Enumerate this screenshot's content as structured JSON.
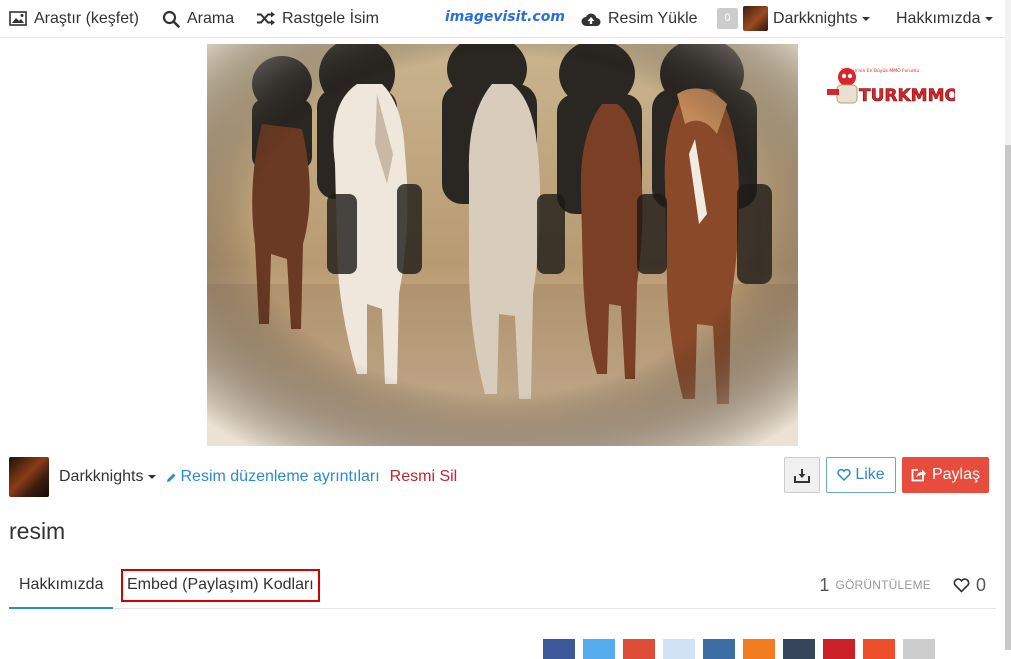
{
  "nav": {
    "explore_label": "Araştır (keşfet)",
    "search_label": "Arama",
    "random_label": "Rastgele İsim",
    "logo_text": "imagevisit.com",
    "upload_label": "Resim Yükle",
    "notification_count": "0",
    "user_label": "Darkknights",
    "about_label": "Hakkımızda"
  },
  "ad": {
    "brand_text": "TURKMMO",
    "tagline": "Türkiye'nin En Büyük MMO Forumu"
  },
  "owner": {
    "name": "Darkknights",
    "edit_label": "Resim düzenleme ayrıntıları",
    "delete_label": "Resmi Sil"
  },
  "actions": {
    "like_label": "Like",
    "share_label": "Paylaş"
  },
  "image": {
    "title": "resim"
  },
  "tabs": [
    {
      "label": "Hakkımızda",
      "active": true
    },
    {
      "label": "Embed (Paylaşım) Kodları",
      "active": false,
      "highlighted": true
    }
  ],
  "stats": {
    "views": "1",
    "views_label": "GÖRÜNTÜLEME",
    "likes": "0"
  },
  "social_colors": [
    "#3b5998",
    "#55acee",
    "#dd4b39",
    "#cfe3f5",
    "#3d6ea3",
    "#f47c20",
    "#35465c",
    "#cb2027",
    "#ee4e2a",
    "#cccccc"
  ],
  "colors": {
    "accent": "#2a8ad4",
    "share": "#e84c3d",
    "danger": "#c0262c",
    "highlight": "#d40000"
  }
}
